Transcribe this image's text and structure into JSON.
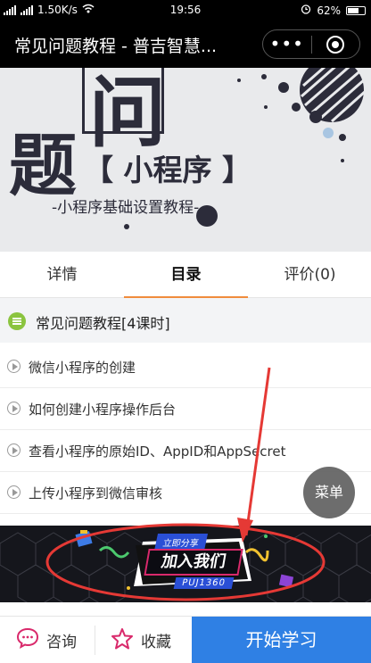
{
  "status_bar": {
    "network_speed": "1.50K/s",
    "time": "19:56",
    "battery": "62%"
  },
  "nav": {
    "title": "常见问题教程 - 普吉智慧...",
    "more_glyph": "•••"
  },
  "banner": {
    "char_wen": "问",
    "char_ti": "题",
    "program_text": "【 小程序 】",
    "subtitle": "-小程序基础设置教程-"
  },
  "tabs": [
    {
      "label": "详情",
      "active": false
    },
    {
      "label": "目录",
      "active": true
    },
    {
      "label": "评价(0)",
      "active": false
    }
  ],
  "chapter": {
    "title": "常见问题教程[4课时]"
  },
  "lessons": [
    {
      "label": "微信小程序的创建"
    },
    {
      "label": "如何创建小程序操作后台"
    },
    {
      "label": "查看小程序的原始ID、AppID和AppSecret"
    },
    {
      "label": "上传小程序到微信审核"
    }
  ],
  "menu_fab": "菜单",
  "promo": {
    "share_label": "立即分享",
    "join_label": "加入我们",
    "code_label": "PUJ1360"
  },
  "bottom_bar": {
    "consult_label": "咨询",
    "favorite_label": "收藏",
    "start_label": "开始学习"
  },
  "colors": {
    "tab_underline": "#f08c3c",
    "chapter_icon": "#8bc43f",
    "start_button": "#2f80e4",
    "annotation_red": "#e53935"
  }
}
